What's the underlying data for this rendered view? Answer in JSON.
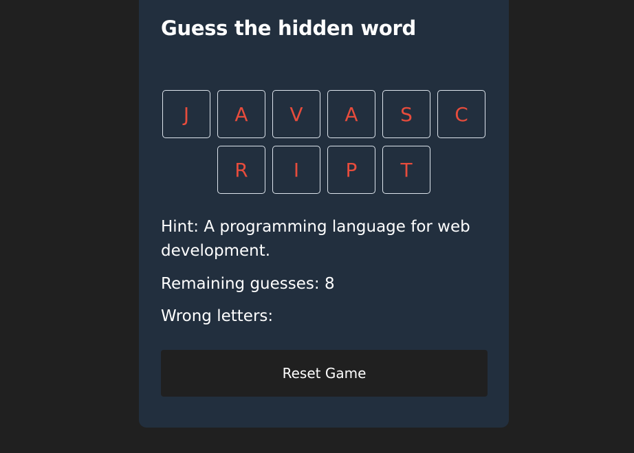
{
  "game": {
    "title": "Guess the hidden word",
    "word_rows": [
      [
        "J",
        "A",
        "V",
        "A",
        "S",
        "C"
      ],
      [
        "R",
        "I",
        "P",
        "T"
      ]
    ],
    "hint_label": "Hint:",
    "hint_text": "A programming language for web development.",
    "remaining_label": "Remaining guesses:",
    "remaining_guesses": "8",
    "wrong_label": "Wrong letters:",
    "wrong_letters": "",
    "reset_label": "Reset Game"
  },
  "colors": {
    "page_background": "#202020",
    "card_background": "#222f3e",
    "letter_color": "#e74c3c",
    "text_color": "#ffffff",
    "button_background": "#202020"
  }
}
